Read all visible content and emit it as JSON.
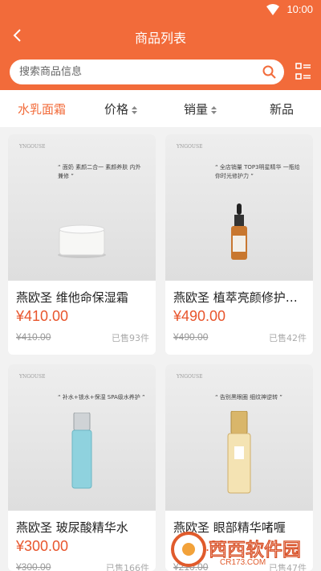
{
  "status": {
    "time": "10:00"
  },
  "nav": {
    "title": "商品列表"
  },
  "search": {
    "placeholder": "搜索商品信息"
  },
  "tabs": [
    {
      "label": "水乳面霜",
      "active": true
    },
    {
      "label": "价格"
    },
    {
      "label": "销量"
    },
    {
      "label": "新品"
    }
  ],
  "products": [
    {
      "name": "燕欧圣 维他命保湿霜",
      "price": "¥410.00",
      "original_price": "¥410.00",
      "sold": "已售93件",
      "slogan": "“ 面奶 素颜二合一 素颜养肤 内外兼修 ”",
      "brand": "YNGOUSE"
    },
    {
      "name": "燕欧圣 植萃亮颜修护精华液",
      "price": "¥490.00",
      "original_price": "¥490.00",
      "sold": "已售42件",
      "slogan": "“ 全店销量 TOP3明星精华 一瓶给你时光修护力 ”",
      "brand": "YNGOUSE"
    },
    {
      "name": "燕欧圣 玻尿酸精华水",
      "price": "¥300.00",
      "original_price": "¥300.00",
      "sold": "已售166件",
      "slogan": "“ 补水+锁水+保湿 SPA级水养护 ”",
      "brand": "YNGOUSE"
    },
    {
      "name": "燕欧圣 眼部精华啫喱",
      "price": "¥210.00",
      "original_price": "¥210.00",
      "sold": "已售47件",
      "slogan": "“ 告别黑眼圈 细纹神逆转 ”",
      "brand": "YNGOUSE"
    }
  ],
  "watermark": {
    "text": "西西软件园",
    "sub": "CR173.COM"
  }
}
